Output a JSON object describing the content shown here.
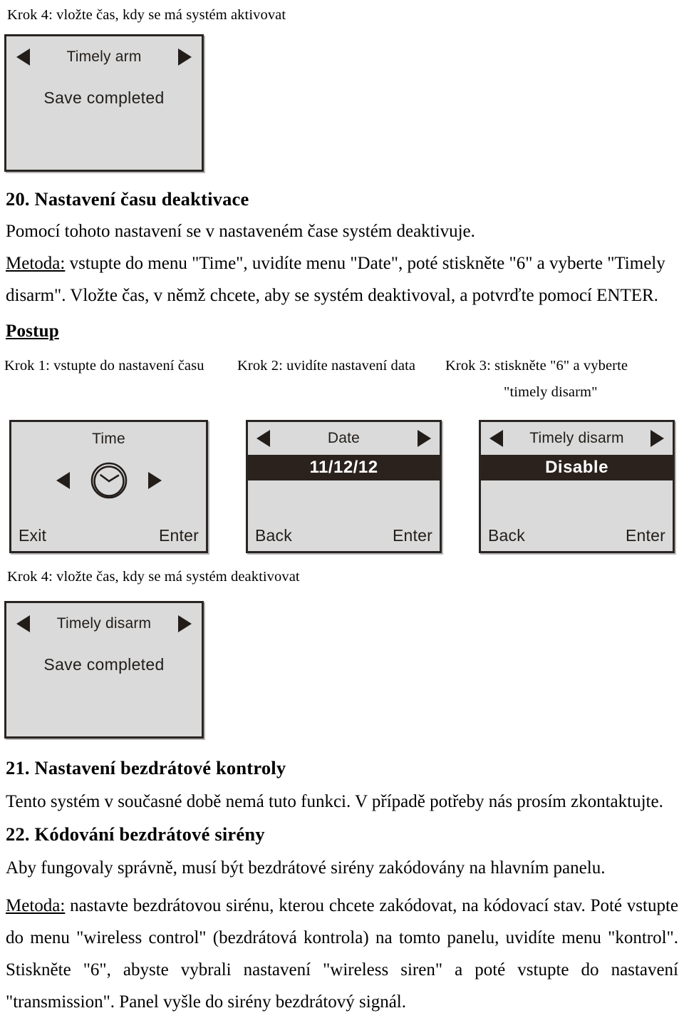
{
  "document": {
    "language": "cs",
    "top_caption": "Krok 4: vložte čas, kdy se má systém aktivovat",
    "section_20": {
      "heading": "20. Nastavení času deaktivace",
      "intro": "Pomocí tohoto nastavení se v nastaveném čase systém deaktivuje.",
      "method_label": "Metoda:",
      "method_line1": " vstupte do menu \"Time\", uvidíte menu \"Date\", poté stiskněte \"6\" a vyberte \"Timely",
      "method_line2": "disarm\". Vložte čas, v němž chcete, aby se systém deaktivoval, a potvrďte pomocí ENTER.",
      "procedure_heading": "Postup",
      "steps": [
        {
          "label": "Krok 1: vstupte do nastavení času"
        },
        {
          "label": "Krok 2: uvidíte nastavení data"
        },
        {
          "label": "Krok 3: stiskněte \"6\" a vyberte",
          "label2": "\"timely disarm\""
        }
      ],
      "step4_caption": "Krok 4: vložte čas, kdy se má systém deaktivovat"
    },
    "section_21": {
      "heading": "21. Nastavení bezdrátové kontroly",
      "body": "Tento systém v současné době nemá tuto funkci. V případě potřeby nás prosím zkontaktujte."
    },
    "section_22": {
      "heading": "22. Kódování bezdrátové sirény",
      "body": "Aby fungovaly správně, musí být bezdrátové sirény zakódovány na hlavním panelu.",
      "method_label": "Metoda:",
      "method_body": " nastavte bezdrátovou sirénu, kterou chcete zakódovat, na kódovací stav. Poté vstupte do menu \"wireless control\" (bezdrátová kontrola) na tomto panelu, uvidíte menu \"kontrol\". Stiskněte \"6\", abyste vybrali nastavení \"wireless siren\" a poté vstupte do nastavení \"transmission\". Panel vyšle do sirény bezdrátový signál."
    }
  },
  "panels": {
    "panel_top": {
      "title": "Timely arm",
      "message": "Save  completed",
      "left_arrow_icon": "triangle-left-icon",
      "right_arrow_icon": "triangle-right-icon"
    },
    "panel_time": {
      "title": "Time",
      "icon": "clock-icon",
      "left_arrow_icon": "triangle-left-icon",
      "right_arrow_icon": "triangle-right-icon",
      "footer_left": "Exit",
      "footer_right": "Enter"
    },
    "panel_date": {
      "title": "Date",
      "highlight_value": "11/12/12",
      "left_arrow_icon": "triangle-left-icon",
      "right_arrow_icon": "triangle-right-icon",
      "footer_left": "Back",
      "footer_right": "Enter"
    },
    "panel_timely_disarm": {
      "title": "Timely disarm",
      "highlight_value": "Disable",
      "left_arrow_icon": "triangle-left-icon",
      "right_arrow_icon": "triangle-right-icon",
      "footer_left": "Back",
      "footer_right": "Enter"
    },
    "panel_bottom": {
      "title": "Timely disarm",
      "message": "Save  completed",
      "left_arrow_icon": "triangle-left-icon",
      "right_arrow_icon": "triangle-right-icon"
    }
  },
  "colors": {
    "lcd_background": "#d9dad9",
    "lcd_border": "#2a2522",
    "lcd_highlight_bg": "#2b221d",
    "lcd_highlight_fg": "#ffffff",
    "text": "#000000"
  }
}
